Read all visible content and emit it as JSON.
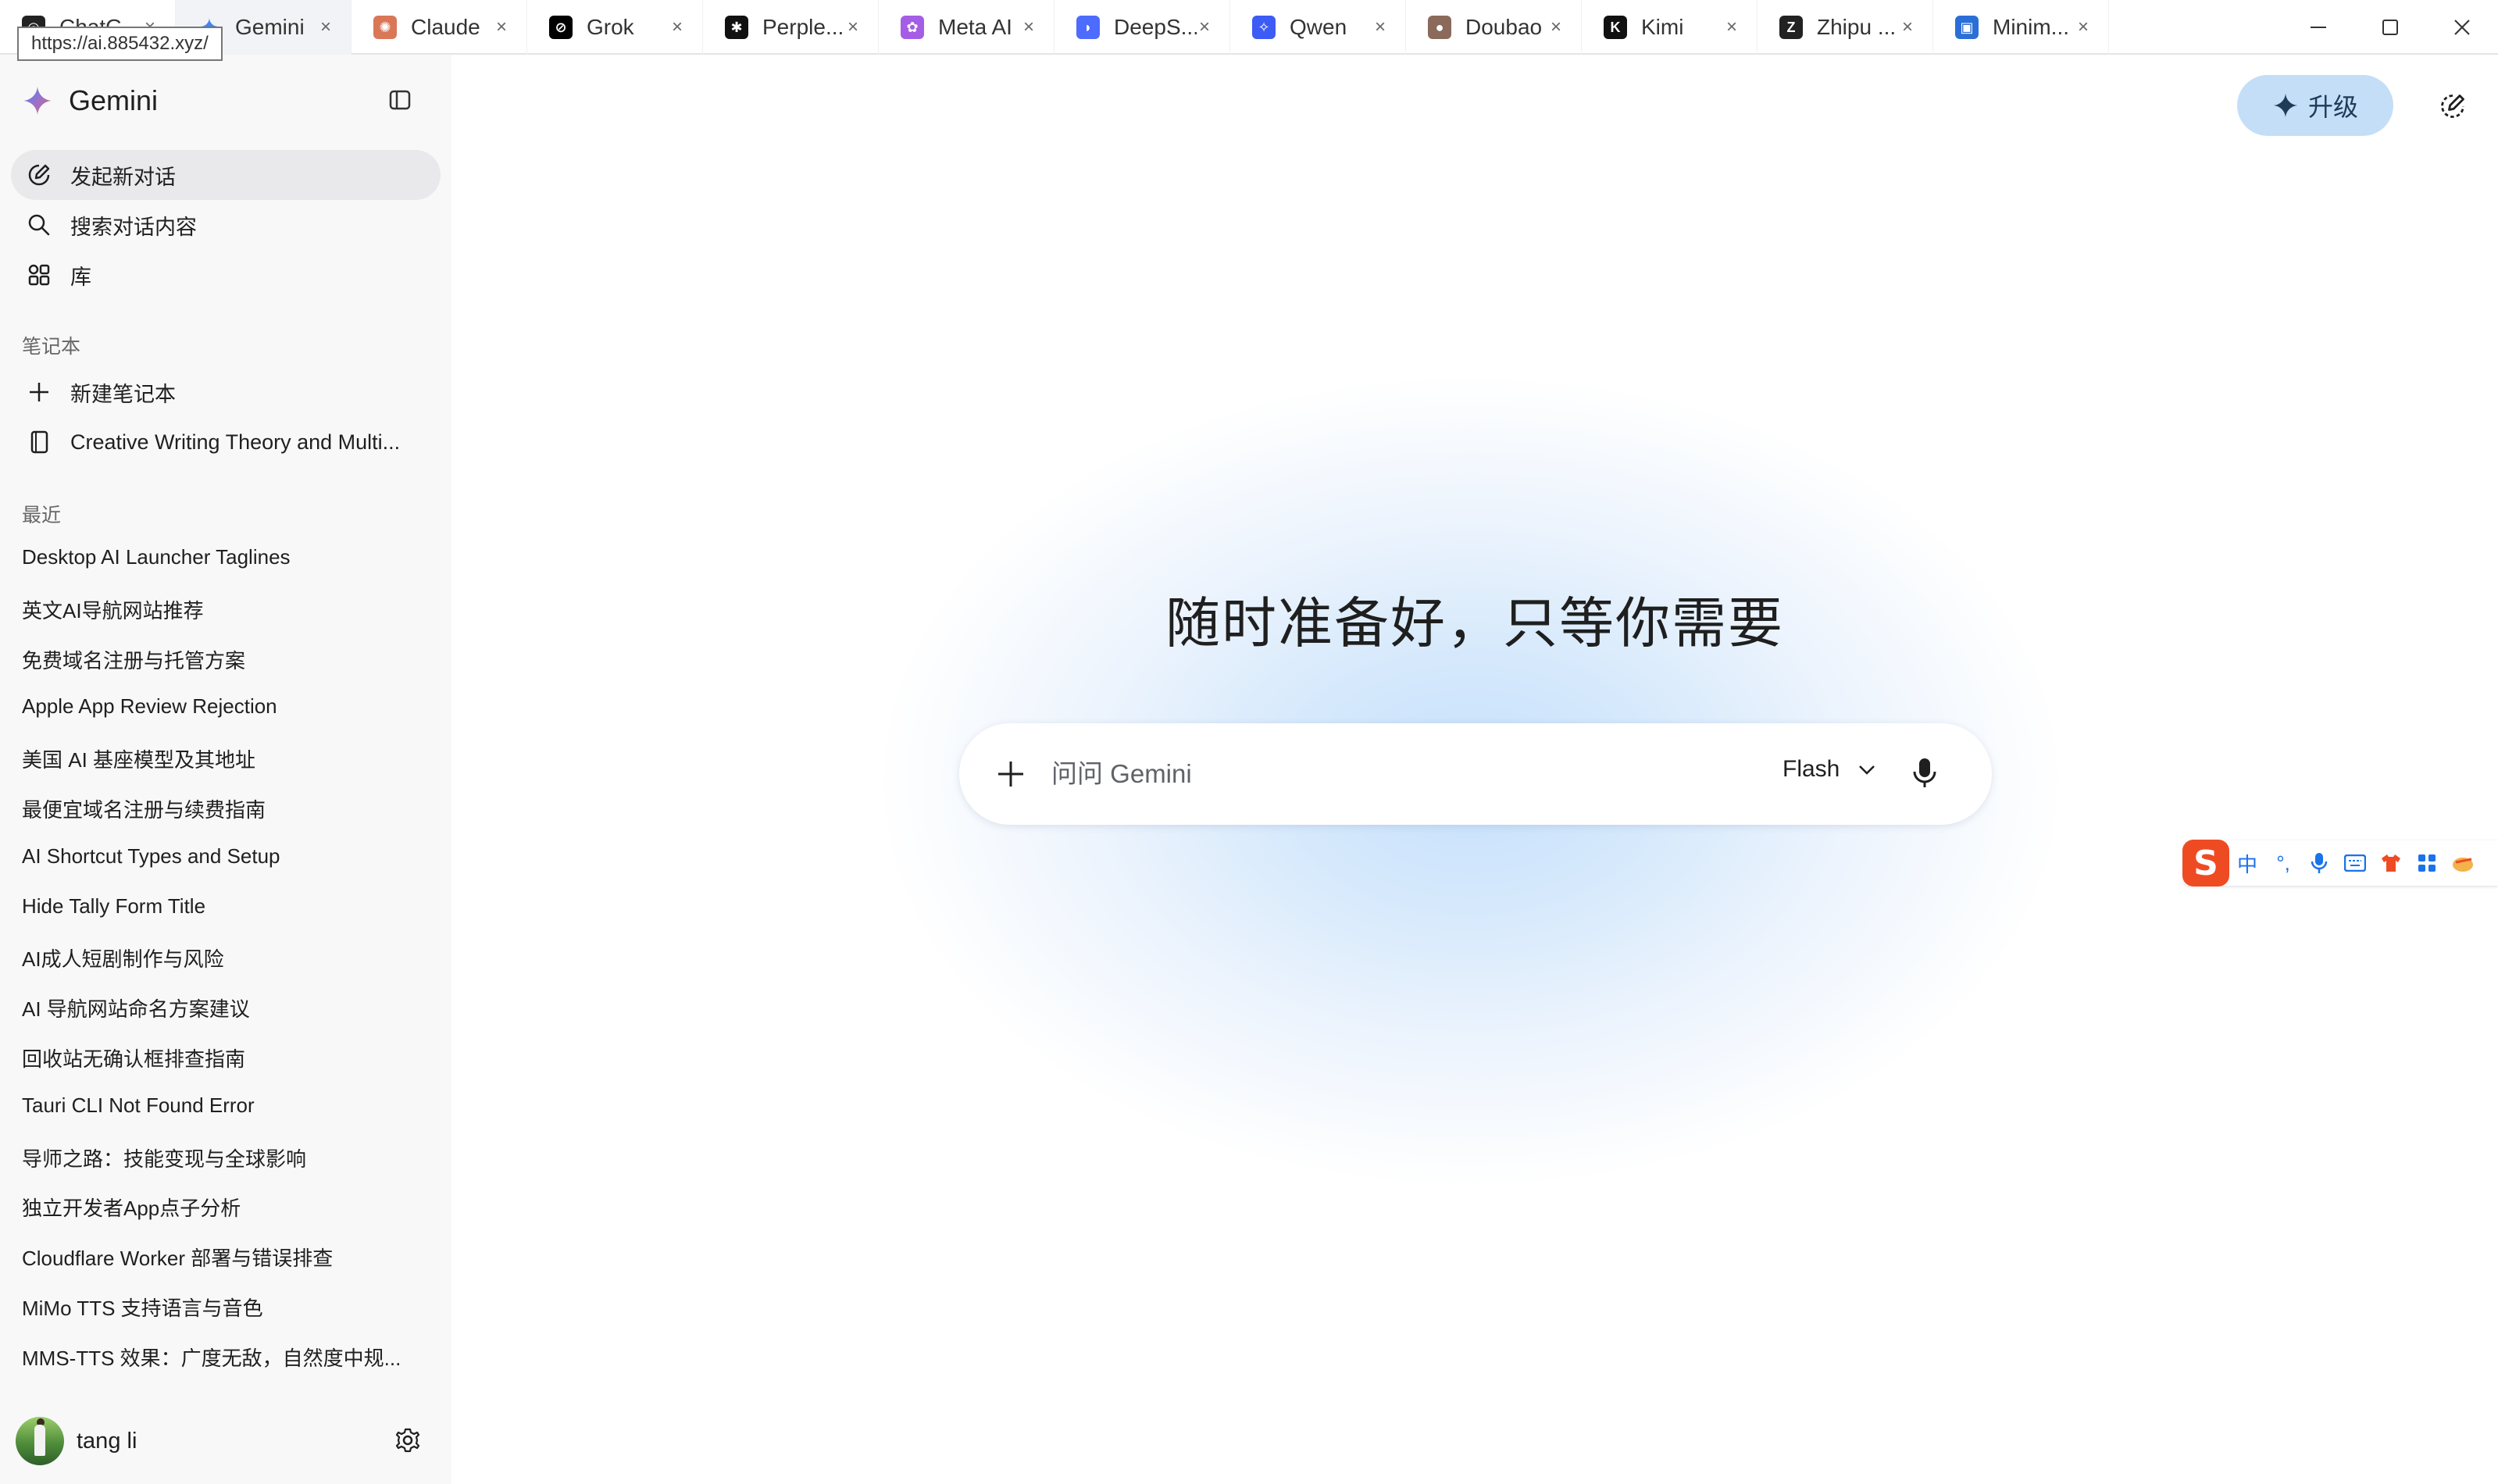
{
  "browser": {
    "url_tooltip": "https://ai.885432.xyz/",
    "tabs": [
      {
        "label": "ChatG...",
        "icon": "chatgpt-icon",
        "color": "#222222",
        "active": false
      },
      {
        "label": "Gemini",
        "icon": "gemini-icon",
        "color": "#4285f4",
        "active": true
      },
      {
        "label": "Claude",
        "icon": "claude-icon",
        "color": "#d97757",
        "active": false
      },
      {
        "label": "Grok",
        "icon": "grok-icon",
        "color": "#000000",
        "active": false
      },
      {
        "label": "Perple...",
        "icon": "perplexity-icon",
        "color": "#111111",
        "active": false
      },
      {
        "label": "Meta AI",
        "icon": "meta-ai-icon",
        "color": "#a55de6",
        "active": false
      },
      {
        "label": "DeepS...",
        "icon": "deepseek-icon",
        "color": "#4d6bfe",
        "active": false
      },
      {
        "label": "Qwen",
        "icon": "qwen-icon",
        "color": "#3d5bf5",
        "active": false
      },
      {
        "label": "Doubao",
        "icon": "doubao-icon",
        "color": "#8a6a5a",
        "active": false
      },
      {
        "label": "Kimi",
        "icon": "kimi-icon",
        "color": "#111111",
        "active": false
      },
      {
        "label": "Zhipu ...",
        "icon": "zhipu-icon",
        "color": "#222222",
        "active": false
      },
      {
        "label": "Minim...",
        "icon": "minimax-icon",
        "color": "#2b6fd6",
        "active": false
      }
    ],
    "tab_close": "×"
  },
  "sidebar": {
    "brand": "Gemini",
    "nav": {
      "new_chat": "发起新对话",
      "search": "搜索对话内容",
      "library": "库"
    },
    "notebooks_label": "笔记本",
    "new_notebook": "新建笔记本",
    "notebook_item": "Creative Writing Theory and Multi...",
    "recent_label": "最近",
    "recent": [
      "Desktop AI Launcher Taglines",
      "英文AI导航网站推荐",
      "免费域名注册与托管方案",
      "Apple App Review Rejection",
      "美国 AI 基座模型及其地址",
      "最便宜域名注册与续费指南",
      "AI Shortcut Types and Setup",
      "Hide Tally Form Title",
      "AI成人短剧制作与风险",
      "AI 导航网站命名方案建议",
      "回收站无确认框排查指南",
      "Tauri CLI Not Found Error",
      "导师之路：技能变现与全球影响",
      "独立开发者App点子分析",
      "Cloudflare Worker 部署与错误排查",
      "MiMo TTS 支持语言与音色",
      "MMS-TTS 效果：广度无敌，自然度中规..."
    ],
    "user_name": "tang li"
  },
  "main": {
    "upgrade_label": "升级",
    "greeting": "随时准备好，只等你需要",
    "prompt_placeholder": "问问 Gemini",
    "model": "Flash"
  },
  "ime": {
    "logo": "S",
    "mode": "中",
    "punct": "°,"
  },
  "colors": {
    "accent": "#1a73e8",
    "upgrade_bg": "#c4def8",
    "ime_brand": "#ef4b23"
  }
}
